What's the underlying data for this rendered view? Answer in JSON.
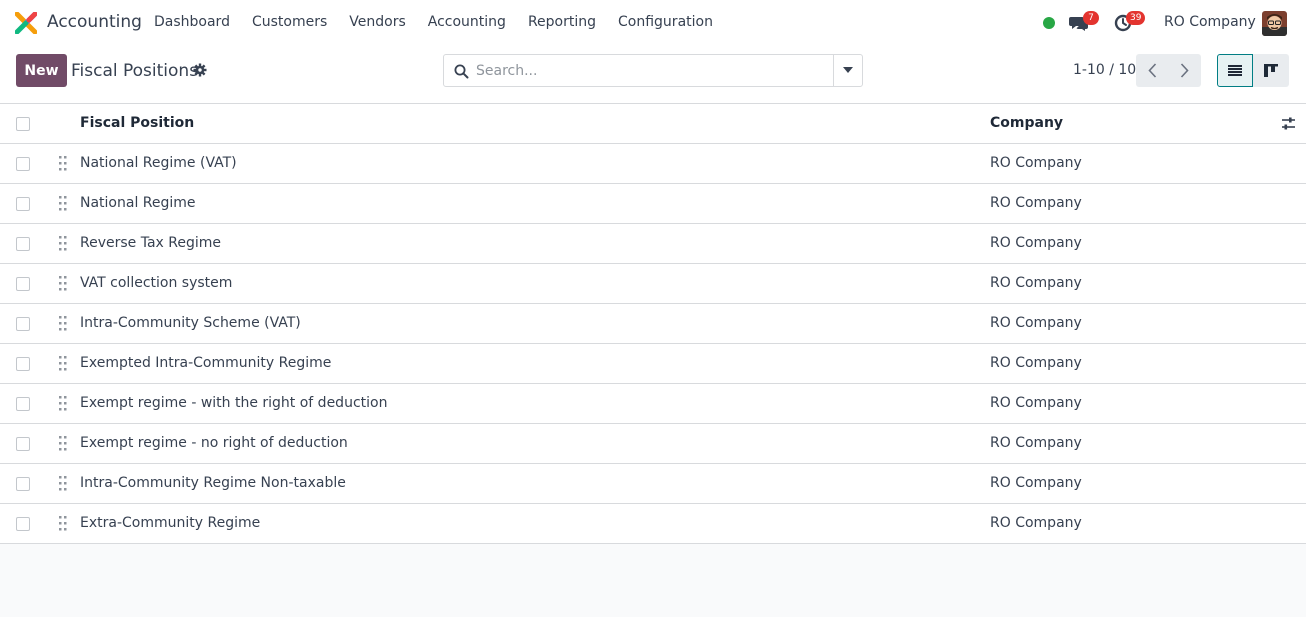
{
  "navbar": {
    "app_name": "Accounting",
    "menu": [
      "Dashboard",
      "Customers",
      "Vendors",
      "Accounting",
      "Reporting",
      "Configuration"
    ],
    "messages_count": "7",
    "activities_count": "39",
    "company": "RO Company",
    "presence_color": "#28a745"
  },
  "control_panel": {
    "new_label": "New",
    "title": "Fiscal Positions",
    "search_placeholder": "Search...",
    "pager": "1-10 / 10"
  },
  "list": {
    "columns": [
      "Fiscal Position",
      "Company"
    ],
    "rows": [
      {
        "name": "National Regime (VAT)",
        "company": "RO Company"
      },
      {
        "name": "National Regime",
        "company": "RO Company"
      },
      {
        "name": "Reverse Tax Regime",
        "company": "RO Company"
      },
      {
        "name": "VAT collection system",
        "company": "RO Company"
      },
      {
        "name": "Intra-Community Scheme (VAT)",
        "company": "RO Company"
      },
      {
        "name": "Exempted Intra-Community Regime",
        "company": "RO Company"
      },
      {
        "name": "Exempt regime - with the right of deduction",
        "company": "RO Company"
      },
      {
        "name": "Exempt regime - no right of deduction",
        "company": "RO Company"
      },
      {
        "name": "Intra-Community Regime Non-taxable",
        "company": "RO Company"
      },
      {
        "name": "Extra-Community Regime",
        "company": "RO Company"
      }
    ]
  },
  "colors": {
    "brand": "#714b67",
    "active_view": "#017e84",
    "badge": "#e3342f"
  },
  "icons": [
    "app-logo-icon",
    "chat-icon",
    "clock-icon",
    "gear-icon",
    "search-icon",
    "caret-down-icon",
    "chevron-left-icon",
    "chevron-right-icon",
    "list-view-icon",
    "kanban-view-icon",
    "drag-handle-icon",
    "sliders-icon"
  ]
}
